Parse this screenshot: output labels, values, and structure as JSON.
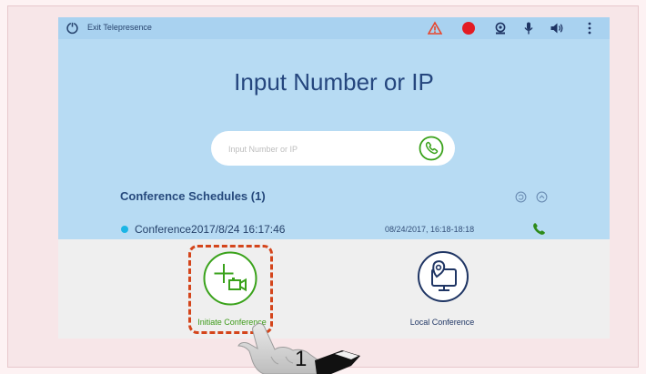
{
  "topbar": {
    "exit_label": "Exit Telepresence",
    "icons": [
      "power-icon",
      "warning-icon",
      "record-icon",
      "camera-icon",
      "microphone-icon",
      "speaker-icon",
      "more-icon"
    ]
  },
  "main": {
    "heading": "Input Number or IP",
    "search_placeholder": "Input Number or IP"
  },
  "schedules": {
    "title": "Conference Schedules (1)",
    "items": [
      {
        "name": "Conference2017/8/24 16:17:46",
        "time": "08/24/2017, 16:18-18:18"
      }
    ]
  },
  "actions": {
    "initiate_label": "Initiate Conference",
    "local_label": "Local Conference"
  },
  "annotation": {
    "step_number": "1"
  },
  "colors": {
    "accent_blue": "#25467e",
    "green": "#3c9a18",
    "highlight": "#d4451b",
    "record": "#e31b23",
    "warning": "#e8452c"
  }
}
